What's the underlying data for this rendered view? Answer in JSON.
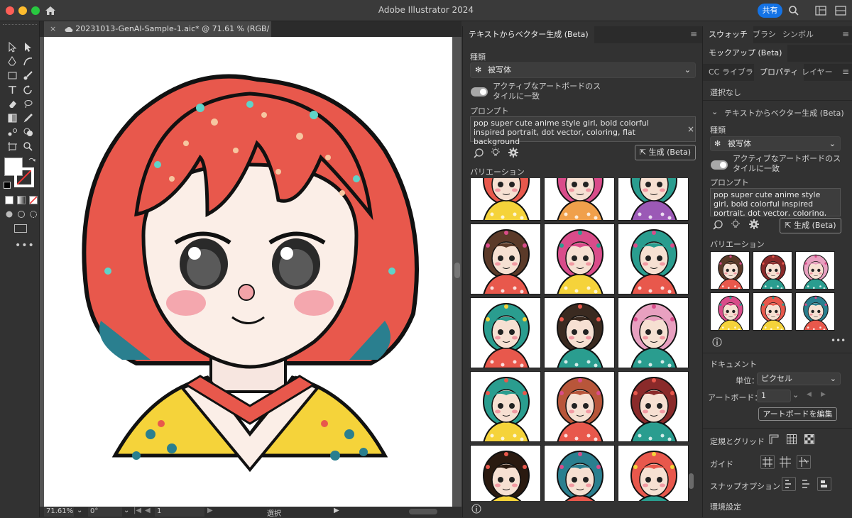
{
  "window": {
    "title": "Adobe Illustrator 2024",
    "share_label": "共有"
  },
  "document": {
    "tab_label": "20231013-GenAI-Sample-1.aic* @ 71.61 % (RGB/プレビュー)",
    "close_glyph": "×"
  },
  "status": {
    "zoom": "71.61%",
    "rotation": "0°",
    "artboard": "1",
    "mode": "選択"
  },
  "middle_panel": {
    "tab_label": "テキストからベクター生成 (Beta)",
    "type_label": "種類",
    "type_value": "被写体",
    "match_label_line1": "アクティブなアートボードのス",
    "match_label_line2": "タイルに一致",
    "prompt_label": "プロンプト",
    "prompt_text": "pop super cute anime style girl, bold colorful inspired portrait, dot vector, coloring, flat background",
    "generate_label": "生成 (Beta)",
    "variations_label": "バリエーション",
    "clear_glyph": "×"
  },
  "right_panel": {
    "tabs_top": [
      "スウォッチ",
      "ブラシ",
      "シンボル"
    ],
    "mockup_tab": "モックアップ (Beta)",
    "tabs_second": [
      "CC ライブラリ",
      "プロパティ",
      "レイヤー"
    ],
    "no_selection": "選択なし",
    "section_title": "テキストからベクター生成 (Beta)",
    "type_label": "種類",
    "type_value": "被写体",
    "match_label_line1": "アクティブなアートボードのス",
    "match_label_line2": "タイルに一致",
    "prompt_label": "プロンプト",
    "prompt_text": "pop super cute anime style girl, bold colorful inspired portrait, dot vector, coloring, flat",
    "generate_label": "生成 (Beta)",
    "variations_label": "バリエーション",
    "document_label": "ドキュメント",
    "units_label": "単位：",
    "units_value": "ピクセル",
    "artboard_label": "アートボード：",
    "artboard_value": "1",
    "edit_artboard_label": "アートボードを編集",
    "rulers_label": "定規とグリッド",
    "guides_label": "ガイド",
    "snap_label": "スナップオプション",
    "prefs_label": "環境設定"
  },
  "colors": {
    "accent": "#1473e6",
    "hair": "#e8584c",
    "teal": "#2a9d8f",
    "yellow": "#f5d33a"
  },
  "icons": [
    "home-icon",
    "search-icon",
    "workspace-icon",
    "cloud-icon",
    "refresh-icon",
    "lightbulb-icon",
    "gear-icon",
    "info-icon",
    "more-icon"
  ]
}
